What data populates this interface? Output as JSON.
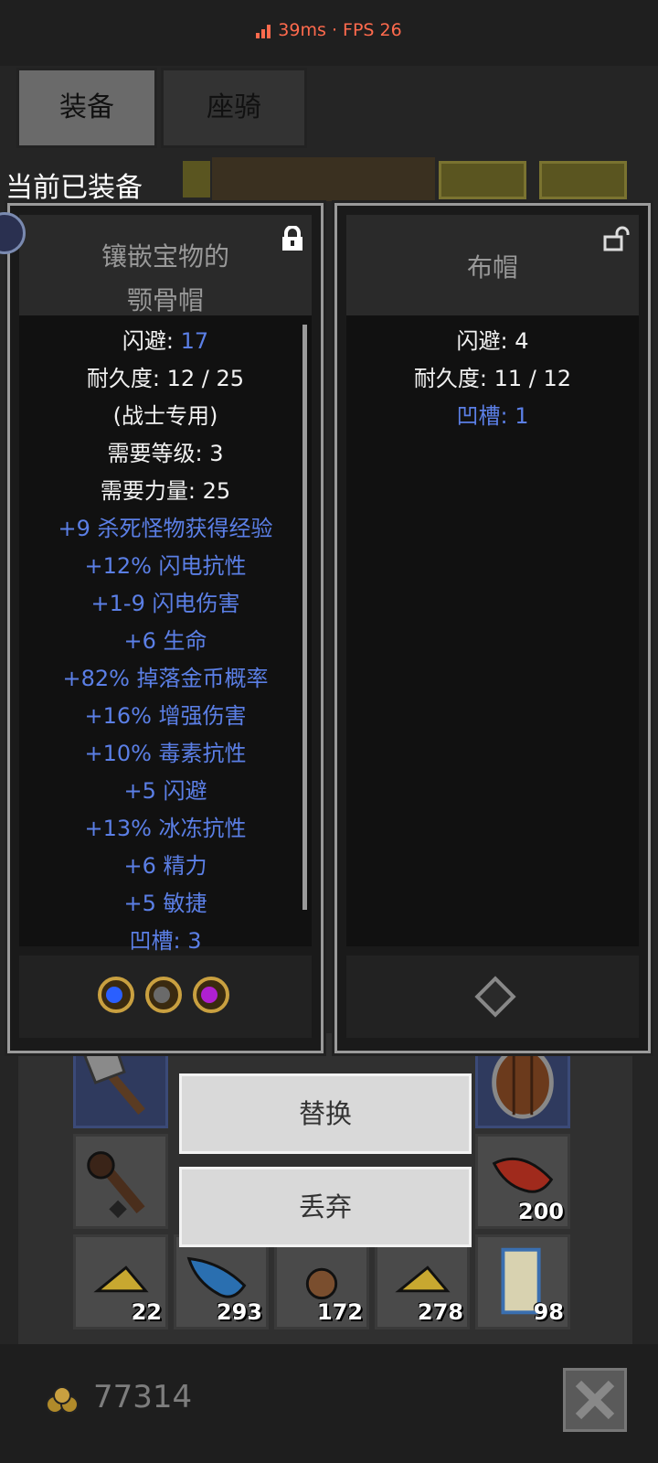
{
  "status": {
    "ping": "39ms",
    "separator": "·",
    "fps": "FPS 26"
  },
  "tabs": [
    {
      "label": "装备",
      "active": true
    },
    {
      "label": "座骑",
      "active": false
    }
  ],
  "equipped_label": "当前已装备",
  "left_item": {
    "title_line1": "镶嵌宝物的",
    "title_line2": "颚骨帽",
    "locked": true,
    "stats": [
      {
        "label": "闪避: ",
        "value": "17",
        "label_color": "white",
        "value_color": "blue"
      },
      {
        "label": "耐久度: 12 / 25",
        "value": "",
        "label_color": "white"
      },
      {
        "label": "(战士专用)",
        "value": "",
        "label_color": "white"
      },
      {
        "label": "需要等级: 3",
        "value": "",
        "label_color": "white"
      },
      {
        "label": "需要力量: 25",
        "value": "",
        "label_color": "white"
      },
      {
        "label": "+9 杀死怪物获得经验",
        "value": "",
        "label_color": "blue"
      },
      {
        "label": "+12% 闪电抗性",
        "value": "",
        "label_color": "blue"
      },
      {
        "label": "+1-9 闪电伤害",
        "value": "",
        "label_color": "blue"
      },
      {
        "label": "+6 生命",
        "value": "",
        "label_color": "blue"
      },
      {
        "label": "+82% 掉落金币概率",
        "value": "",
        "label_color": "blue"
      },
      {
        "label": "+16% 增强伤害",
        "value": "",
        "label_color": "blue"
      },
      {
        "label": "+10% 毒素抗性",
        "value": "",
        "label_color": "blue"
      },
      {
        "label": "+5 闪避",
        "value": "",
        "label_color": "blue"
      },
      {
        "label": "+13% 冰冻抗性",
        "value": "",
        "label_color": "blue"
      },
      {
        "label": "+6 精力",
        "value": "",
        "label_color": "blue"
      },
      {
        "label": "+5 敏捷",
        "value": "",
        "label_color": "blue"
      },
      {
        "label": "凹槽: 3",
        "value": "",
        "label_color": "blue"
      }
    ],
    "sockets": [
      "blue-gem-icon",
      "grey-gem-icon",
      "purple-gem-icon"
    ]
  },
  "right_item": {
    "title": "布帽",
    "locked": false,
    "stats": [
      {
        "label": "闪避: 4",
        "label_color": "white"
      },
      {
        "label": "耐久度: 11 / 12",
        "label_color": "white"
      },
      {
        "label": "凹槽: 1",
        "label_color": "blue"
      }
    ],
    "sockets": [
      "empty-socket-icon"
    ]
  },
  "buttons": {
    "replace": "替换",
    "discard": "丢弃"
  },
  "inventory": {
    "row1": [
      {
        "icon": "axe-icon",
        "qty": ""
      },
      {
        "icon": "round-shield-icon",
        "qty": ""
      }
    ],
    "row2": [
      {
        "icon": "spiked-club-icon",
        "qty": ""
      },
      {
        "icon": "red-meat-icon",
        "qty": "200"
      }
    ],
    "row3": [
      {
        "icon": "cheese-icon",
        "qty": "22"
      },
      {
        "icon": "blue-fish-icon",
        "qty": "293"
      },
      {
        "icon": "brown-nut-icon",
        "qty": "172"
      },
      {
        "icon": "cheese-icon",
        "qty": "278"
      },
      {
        "icon": "scroll-icon",
        "qty": "98"
      }
    ]
  },
  "gold": "77314",
  "colors": {
    "blue_text": "#5b7fe6",
    "status_orange": "#ff6a4d"
  }
}
